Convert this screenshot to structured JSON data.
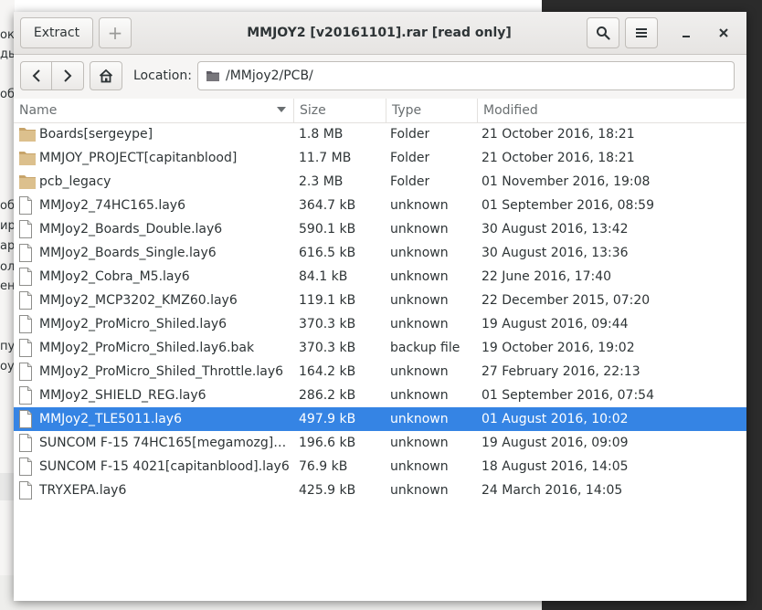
{
  "background": {
    "left_fragments": [
      "ок",
      "ды",
      "об",
      "об",
      "ир",
      "ар",
      "ол",
      "ено",
      "пу",
      "оуВ"
    ]
  },
  "window": {
    "title": "MMJOY2 [v20161101].rar [read only]",
    "extract_label": "Extract",
    "add_label": "+",
    "search_icon": "search-icon",
    "menu_icon": "hamburger-menu-icon",
    "minimize_label": "–",
    "close_label": "✕"
  },
  "location": {
    "label": "Location:",
    "path": "/MMjoy2/PCB/"
  },
  "columns": {
    "name": "Name",
    "size": "Size",
    "type": "Type",
    "modified": "Modified"
  },
  "colors": {
    "selection": "#3584e4",
    "folder": "#d4b781"
  },
  "files": [
    {
      "kind": "folder",
      "name": "Boards[sergeype]",
      "size": "1.8 MB",
      "type": "Folder",
      "modified": "21 October 2016, 18:21"
    },
    {
      "kind": "folder",
      "name": "MMJOY_PROJECT[capitanblood]",
      "size": "11.7 MB",
      "type": "Folder",
      "modified": "21 October 2016, 18:21"
    },
    {
      "kind": "folder",
      "name": "pcb_legacy",
      "size": "2.3 MB",
      "type": "Folder",
      "modified": "01 November 2016, 19:08"
    },
    {
      "kind": "file",
      "name": "MMJoy2_74HC165.lay6",
      "size": "364.7 kB",
      "type": "unknown",
      "modified": "01 September 2016, 08:59"
    },
    {
      "kind": "file",
      "name": "MMJoy2_Boards_Double.lay6",
      "size": "590.1 kB",
      "type": "unknown",
      "modified": "30 August 2016, 13:42"
    },
    {
      "kind": "file",
      "name": "MMJoy2_Boards_Single.lay6",
      "size": "616.5 kB",
      "type": "unknown",
      "modified": "30 August 2016, 13:36"
    },
    {
      "kind": "file",
      "name": "MMJoy2_Cobra_M5.lay6",
      "size": "84.1 kB",
      "type": "unknown",
      "modified": "22 June 2016, 17:40"
    },
    {
      "kind": "file",
      "name": "MMJoy2_MCP3202_KMZ60.lay6",
      "size": "119.1 kB",
      "type": "unknown",
      "modified": "22 December 2015, 07:20"
    },
    {
      "kind": "file",
      "name": "MMJoy2_ProMicro_Shiled.lay6",
      "size": "370.3 kB",
      "type": "unknown",
      "modified": "19 August 2016, 09:44"
    },
    {
      "kind": "file",
      "name": "MMJoy2_ProMicro_Shiled.lay6.bak",
      "size": "370.3 kB",
      "type": "backup file",
      "modified": "19 October 2016, 19:02"
    },
    {
      "kind": "file",
      "name": "MMJoy2_ProMicro_Shiled_Throttle.lay6",
      "size": "164.2 kB",
      "type": "unknown",
      "modified": "27 February 2016, 22:13"
    },
    {
      "kind": "file",
      "name": "MMJoy2_SHIELD_REG.lay6",
      "size": "286.2 kB",
      "type": "unknown",
      "modified": "01 September 2016, 07:54"
    },
    {
      "kind": "file",
      "name": "MMJoy2_TLE5011.lay6",
      "size": "497.9 kB",
      "type": "unknown",
      "modified": "01 August 2016, 10:02",
      "selected": true
    },
    {
      "kind": "file",
      "name": "SUNCOM F-15 74HC165[megamozg].la...",
      "size": "196.6 kB",
      "type": "unknown",
      "modified": "19 August 2016, 09:09"
    },
    {
      "kind": "file",
      "name": "SUNCOM F-15 4021[capitanblood].lay6",
      "size": "76.9 kB",
      "type": "unknown",
      "modified": "18 August 2016, 14:05"
    },
    {
      "kind": "file",
      "name": "TRYXEPA.lay6",
      "size": "425.9 kB",
      "type": "unknown",
      "modified": "24 March 2016, 14:05"
    }
  ]
}
